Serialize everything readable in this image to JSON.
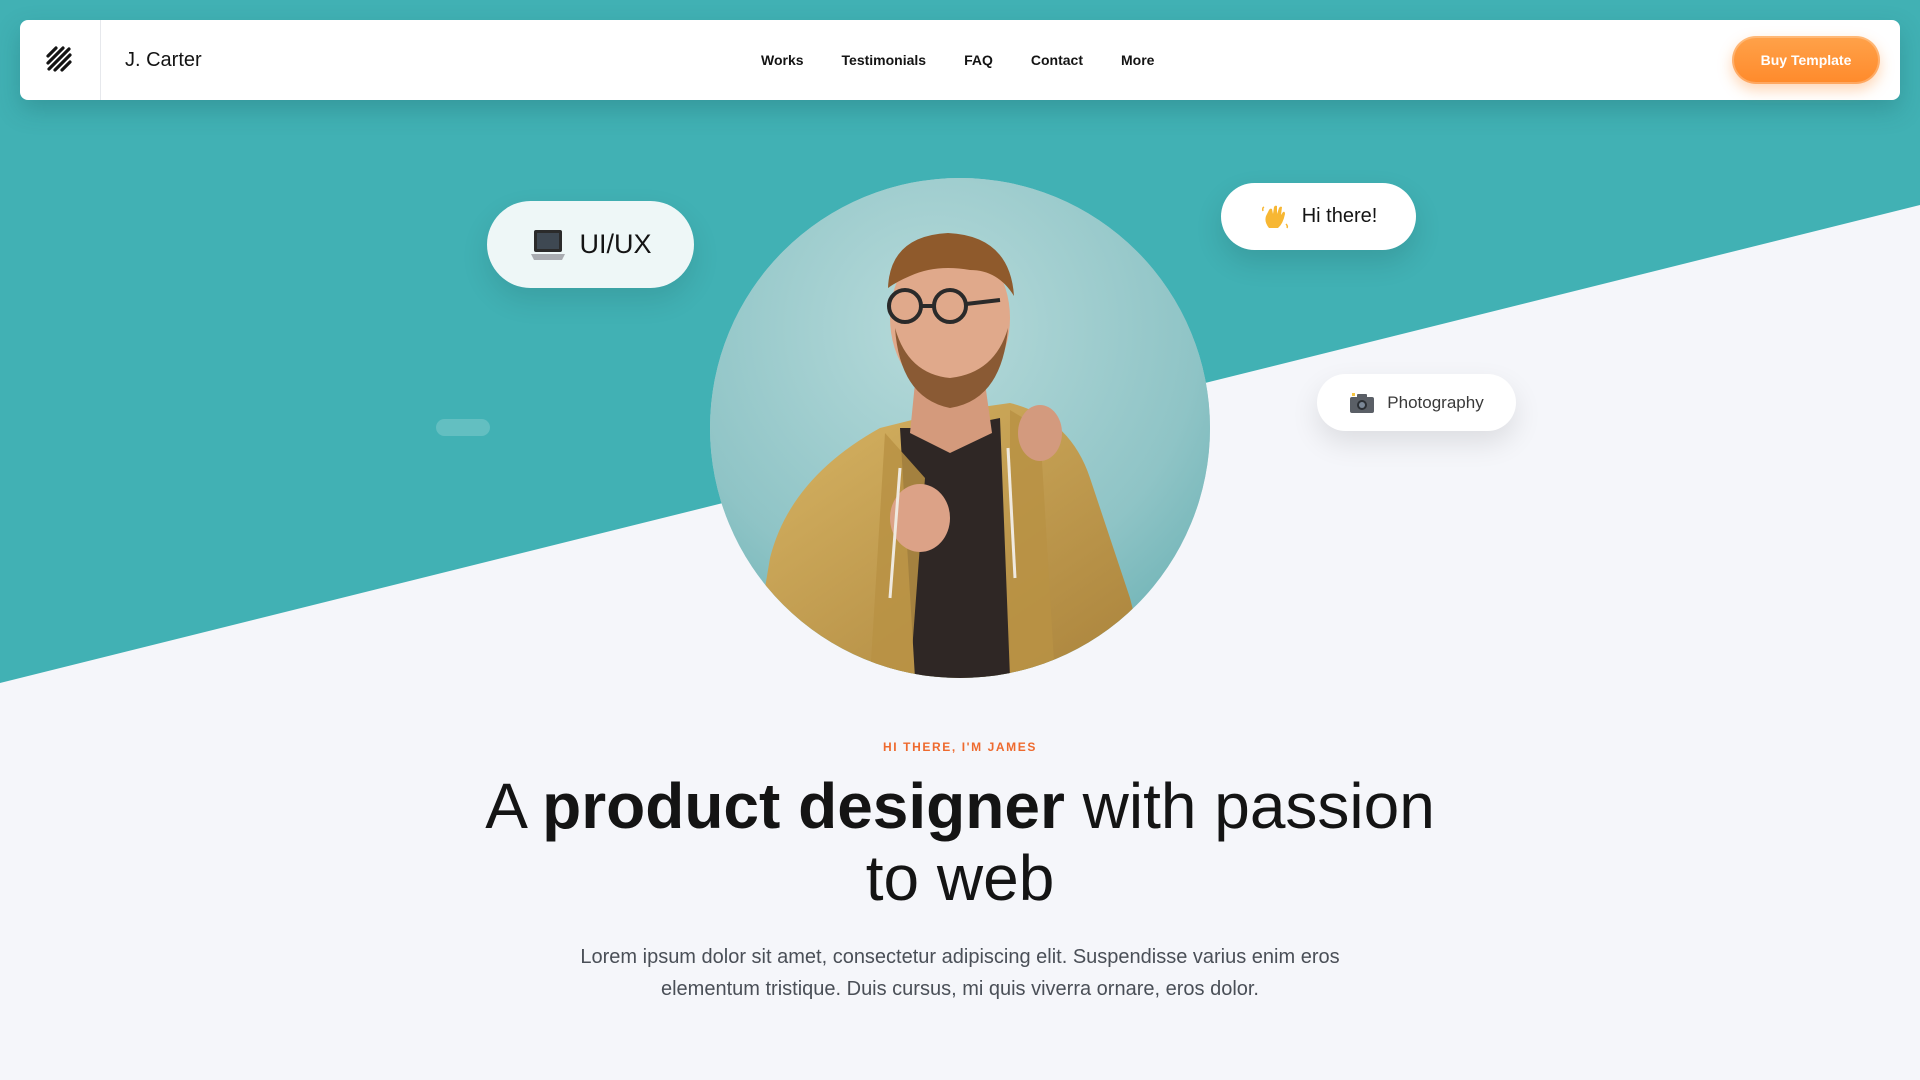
{
  "brand": {
    "name": "J. Carter",
    "logo_icon": "diagonal-stripes-logo-icon"
  },
  "nav": {
    "links": [
      "Works",
      "Testimonials",
      "FAQ",
      "Contact",
      "More"
    ],
    "cta_label": "Buy Template"
  },
  "hero": {
    "tags": {
      "uiux": {
        "label": "UI/UX",
        "icon": "laptop-icon"
      },
      "greeting": {
        "label": "Hi there!",
        "icon": "waving-hand-icon"
      },
      "photography": {
        "label": "Photography",
        "icon": "camera-icon"
      }
    },
    "eyebrow": "HI THERE, I'M JAMES",
    "headline_pre": "A ",
    "headline_bold": "product designer",
    "headline_post": " with passion to web",
    "description": "Lorem ipsum dolor sit amet, consectetur adipiscing elit. Suspendisse varius enim eros elementum tristique. Duis cursus, mi quis viverra ornare, eros dolor."
  },
  "colors": {
    "teal": "#41b1b4",
    "page_bg": "#f5f6fa",
    "accent_orange": "#ff8a2b",
    "eyebrow_orange": "#ee6a2e",
    "text_dark": "#141414"
  }
}
